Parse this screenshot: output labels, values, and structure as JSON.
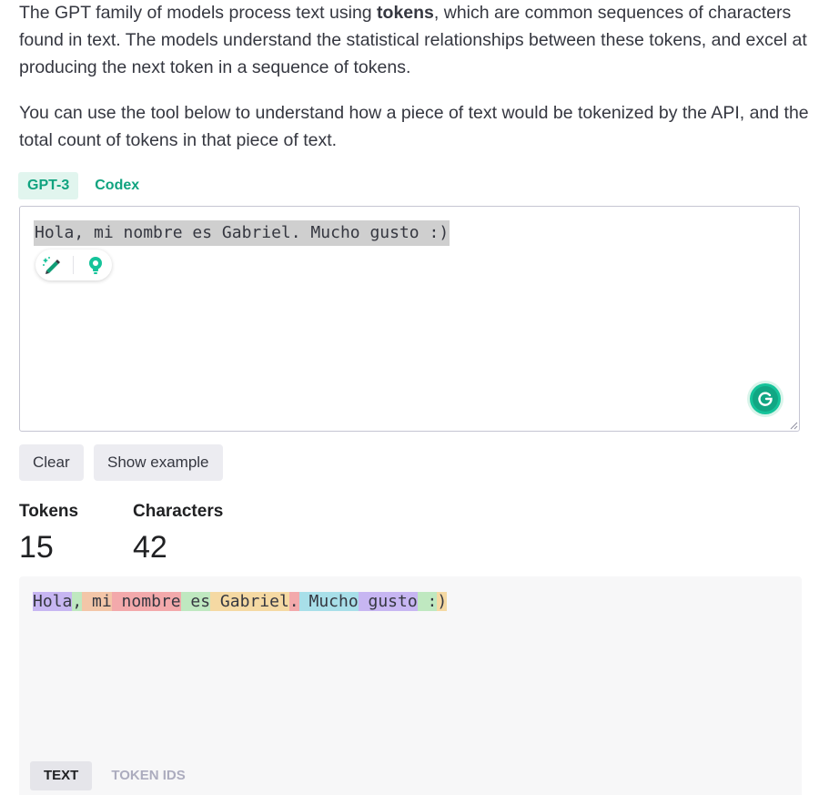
{
  "intro": {
    "p1_before": "The GPT family of models process text using ",
    "p1_bold": "tokens",
    "p1_after": ", which are common sequences of characters found in text. The models understand the statistical relationships between these tokens, and excel at producing the next token in a sequence of tokens.",
    "p2": "You can use the tool below to understand how a piece of text would be tokenized by the API, and the total count of tokens in that piece of text."
  },
  "model_tabs": [
    {
      "label": "GPT-3",
      "active": true
    },
    {
      "label": "Codex",
      "active": false
    }
  ],
  "editor": {
    "value": "Hola, mi nombre es Gabriel. Mucho gusto :)",
    "icons": [
      "magic-pencil-icon",
      "lightbulb-icon",
      "grammarly-icon"
    ]
  },
  "buttons": {
    "clear": "Clear",
    "show_example": "Show example"
  },
  "stats": {
    "tokens_label": "Tokens",
    "tokens_value": "15",
    "characters_label": "Characters",
    "characters_value": "42"
  },
  "output": {
    "tokens": [
      {
        "text": "Hola",
        "color": "#c7b6f2"
      },
      {
        "text": ",",
        "color": "#bfe8c0"
      },
      {
        "text": " mi",
        "color": "#f3c6a8"
      },
      {
        "text": " nombre",
        "color": "#f3a9ab"
      },
      {
        "text": " es",
        "color": "#bfe8c0"
      },
      {
        "text": " Gabriel",
        "color": "#f5d9a3"
      },
      {
        "text": ".",
        "color": "#f3a9ab"
      },
      {
        "text": " Mucho",
        "color": "#a8dfe9"
      },
      {
        "text": " gusto",
        "color": "#c7b6f2"
      },
      {
        "text": " :",
        "color": "#bfe8c0"
      },
      {
        "text": ")",
        "color": "#f5d9a3"
      }
    ],
    "tabs": [
      {
        "label": "TEXT",
        "active": true
      },
      {
        "label": "TOKEN IDS",
        "active": false
      }
    ]
  },
  "colors": {
    "accent": "#10a37f",
    "accent_bg": "#e1f5ee",
    "button_bg": "#ececf1",
    "output_bg": "#f7f7f8"
  }
}
